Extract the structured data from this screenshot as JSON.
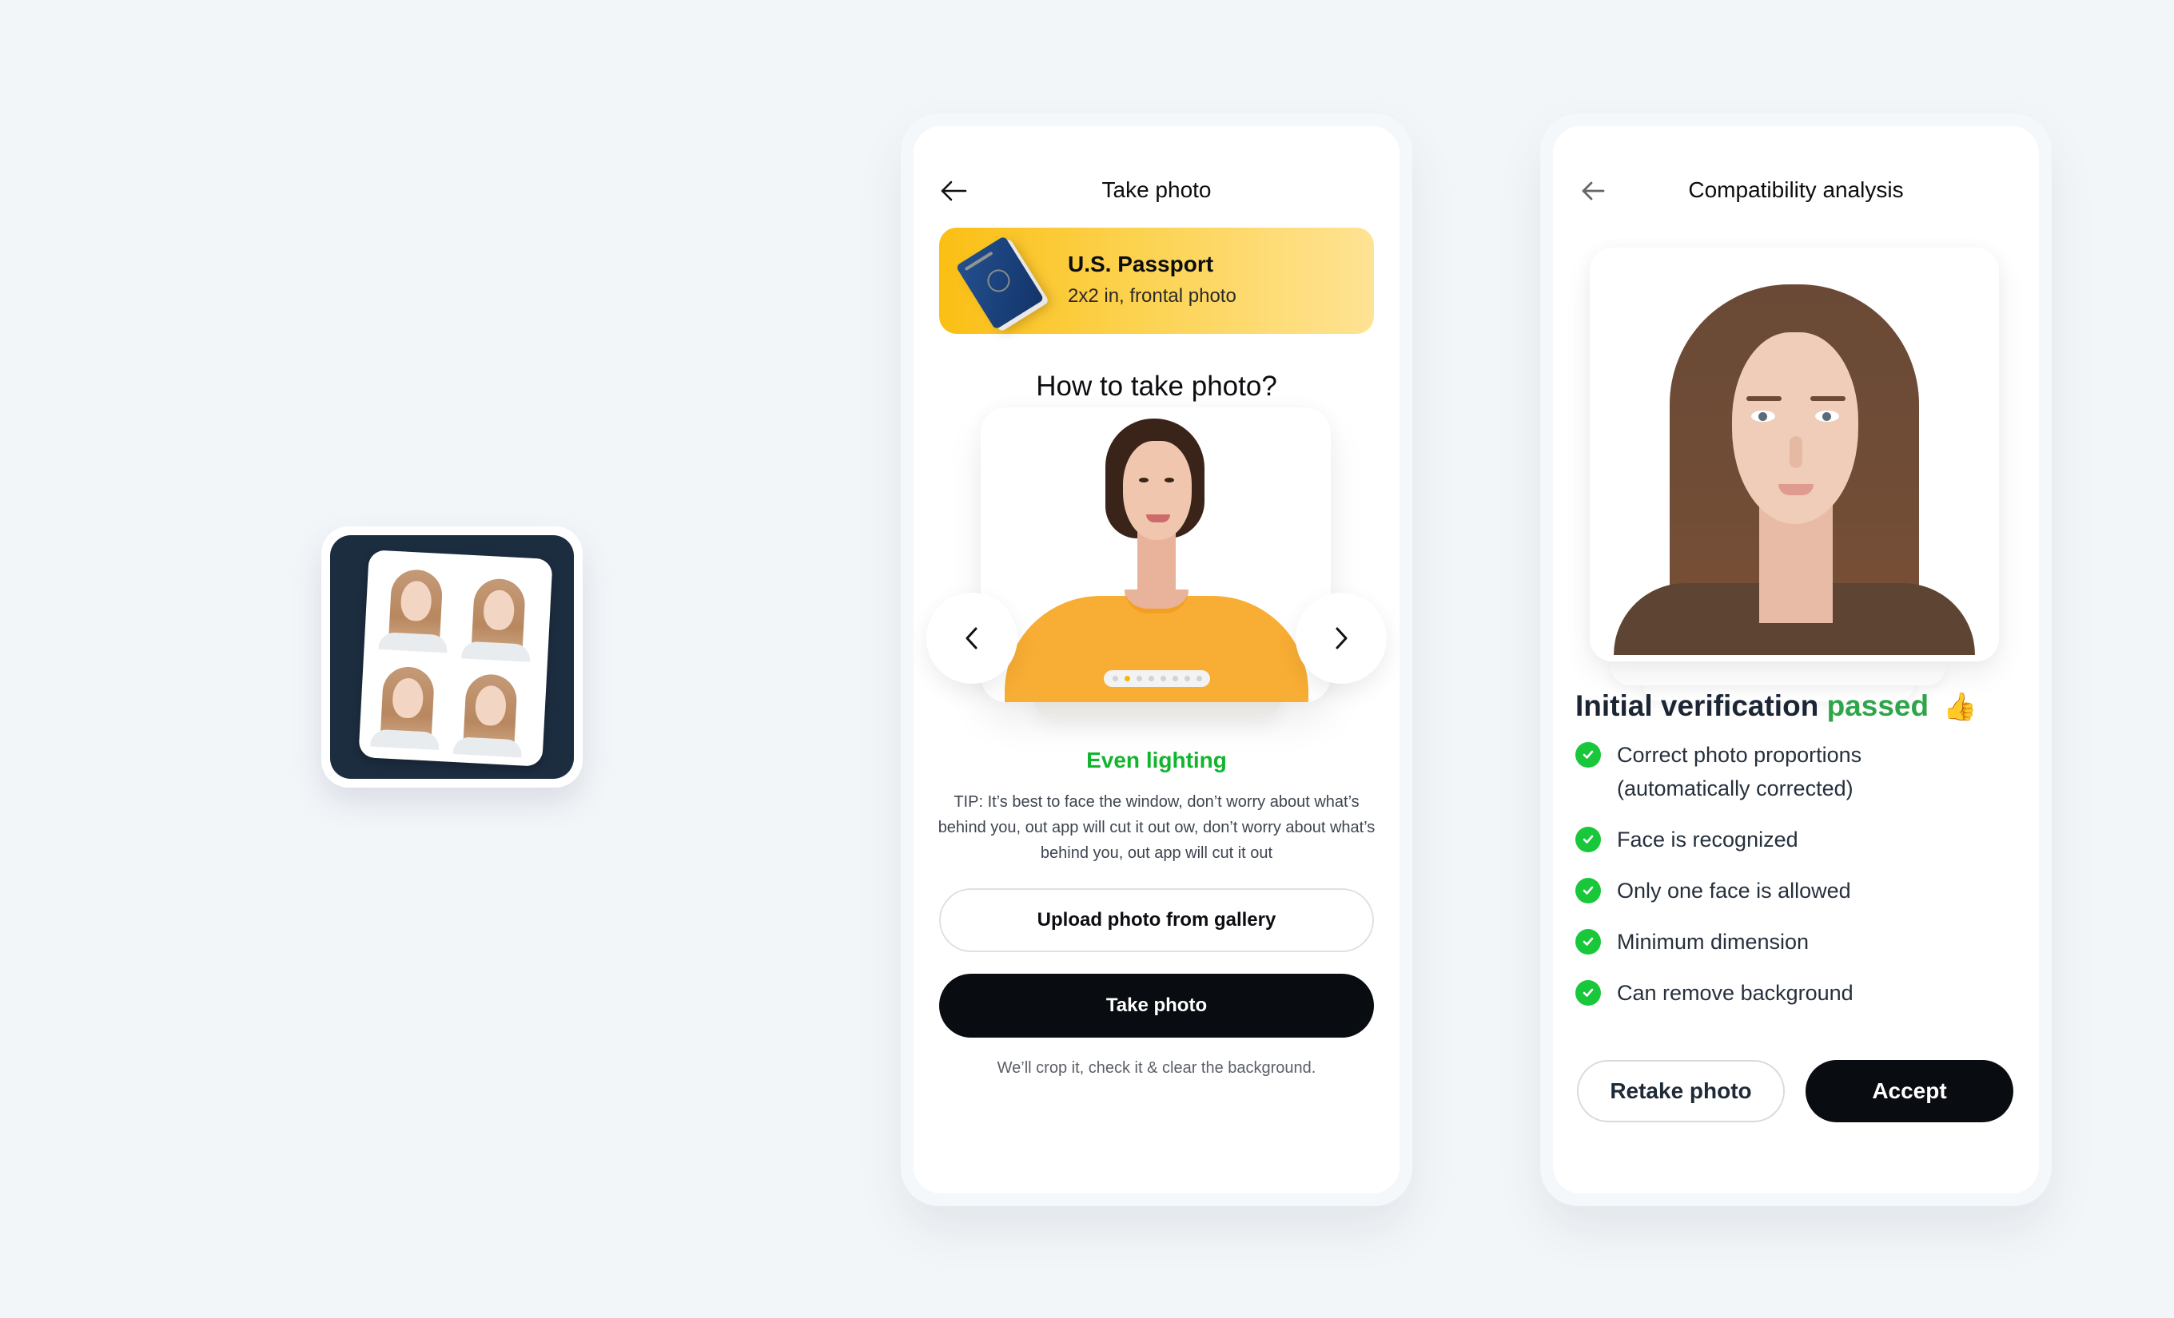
{
  "app_icon": {
    "label": "Passport photo app icon",
    "background_color": "#1c2d40",
    "photo_count": 4
  },
  "take_photo_screen": {
    "title": "Take photo",
    "back_icon": "arrow-left-icon",
    "document": {
      "name": "U.S. Passport",
      "spec": "2x2 in, frontal photo",
      "icon": "passport-icon",
      "gradient": [
        "#fbbf14",
        "#ffe394"
      ]
    },
    "section_title": "How to take photo?",
    "carousel": {
      "prev_icon": "chevron-left-icon",
      "next_icon": "chevron-right-icon",
      "total_slides": 8,
      "active_index": 1
    },
    "tip_title": "Even lighting",
    "tip_title_color": "#13b52e",
    "tip_text": "TIP: It’s best to face the window, don’t worry about what’s behind you, out app will cut it out ow, don’t worry about what’s behind you, out app will cut it out",
    "upload_button": "Upload photo from gallery",
    "take_photo_button": "Take photo",
    "footnote": "We’ll crop it, check it & clear the background."
  },
  "compatibility_screen": {
    "title": "Compatibility analysis",
    "back_icon": "arrow-left-icon",
    "heading_prefix": "Initial verification",
    "heading_status": "passed",
    "heading_emoji": "👍",
    "status_color": "#2fa54a",
    "checks": [
      {
        "label": "Correct photo proportions (automatically corrected)",
        "passed": true
      },
      {
        "label": "Face is recognized",
        "passed": true
      },
      {
        "label": "Only one face is allowed",
        "passed": true
      },
      {
        "label": "Minimum dimension",
        "passed": true
      },
      {
        "label": "Can remove background",
        "passed": true
      }
    ],
    "retake_button": "Retake photo",
    "accept_button": "Accept"
  }
}
